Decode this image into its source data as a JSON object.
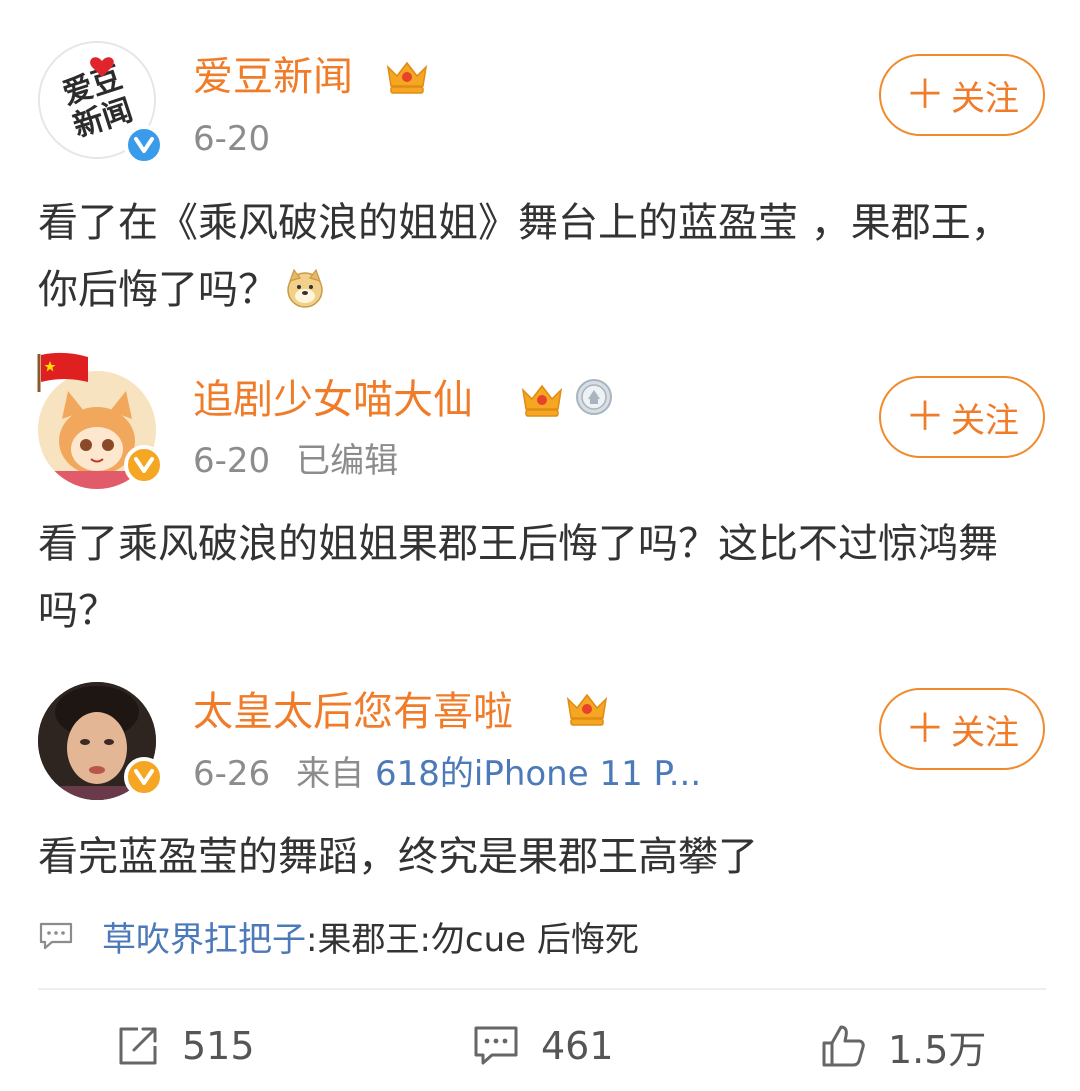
{
  "posts": [
    {
      "username": "爱豆新闻",
      "date": "6-20",
      "edited": "",
      "source_prefix": "",
      "source": "",
      "follow_label": "关注",
      "content": "看了在《乘风破浪的姐姐》舞台上的蓝盈莹 ，果郡王，你后悔了吗？",
      "avatar_text": [
        "爱豆",
        "新闻"
      ],
      "verified": "blue",
      "icons": [
        "crown-icon"
      ]
    },
    {
      "username": "追剧少女喵大仙",
      "date": "6-20",
      "edited": "已编辑",
      "source_prefix": "",
      "source": "",
      "follow_label": "关注",
      "content": "看了乘风破浪的姐姐果郡王后悔了吗？这比不过惊鸿舞吗？",
      "verified": "gold",
      "icons": [
        "crown-icon",
        "medal-icon"
      ]
    },
    {
      "username": "太皇太后您有喜啦",
      "date": "6-26",
      "edited": "",
      "source_prefix": "来自",
      "source": "618的iPhone 11 P...",
      "follow_label": "关注",
      "content": "看完蓝盈莹的舞蹈，终究是果郡王高攀了",
      "verified": "gold",
      "icons": [
        "crown-icon"
      ]
    }
  ],
  "comment_preview": {
    "user": "草吹界扛把子",
    "text": ":果郡王:勿cue 后悔死"
  },
  "actions": {
    "repost_count": "515",
    "comment_count": "461",
    "like_count": "1.5万"
  },
  "colors": {
    "accent": "#f07c2a",
    "link": "#4c79b8",
    "verified_blue": "#3a9bea",
    "verified_gold": "#f5a623",
    "text": "#333333",
    "muted": "#8c8c8c"
  }
}
